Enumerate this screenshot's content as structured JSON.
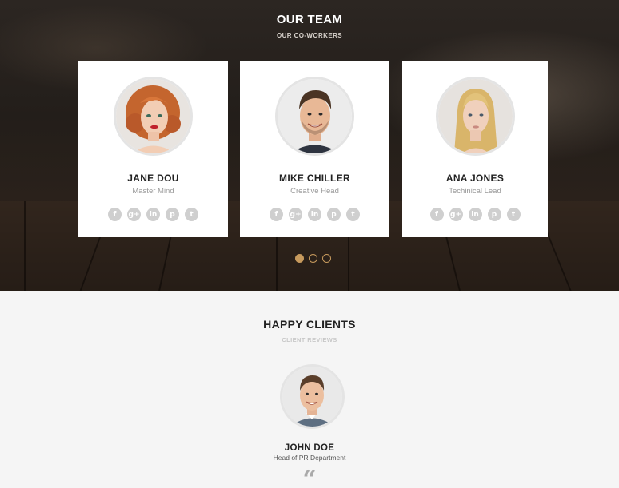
{
  "team": {
    "title": "OUR TEAM",
    "subtitle": "OUR CO-WORKERS",
    "members": [
      {
        "name": "JANE DOU",
        "role": "Master Mind"
      },
      {
        "name": "MIKE CHILLER",
        "role": "Creative Head"
      },
      {
        "name": "ANA JONES",
        "role": "Techinical Lead"
      }
    ],
    "social_icons": [
      "facebook-icon",
      "google-plus-icon",
      "linkedin-icon",
      "pinterest-icon",
      "twitter-icon"
    ],
    "social_glyphs": [
      "f",
      "g+",
      "in",
      "p",
      "t"
    ],
    "carousel": {
      "pages": 3,
      "active": 1
    }
  },
  "clients": {
    "title": "HAPPY CLIENTS",
    "subtitle": "CLIENT REVIEWS",
    "client": {
      "name": "JOHN DOE",
      "role": "Head of PR Department"
    },
    "quote_mark": "“"
  },
  "colors": {
    "accent": "#c79a5d",
    "card_bg": "#ffffff",
    "social_icon_bg": "#cfcfcf",
    "section_bg": "#f5f5f5"
  }
}
